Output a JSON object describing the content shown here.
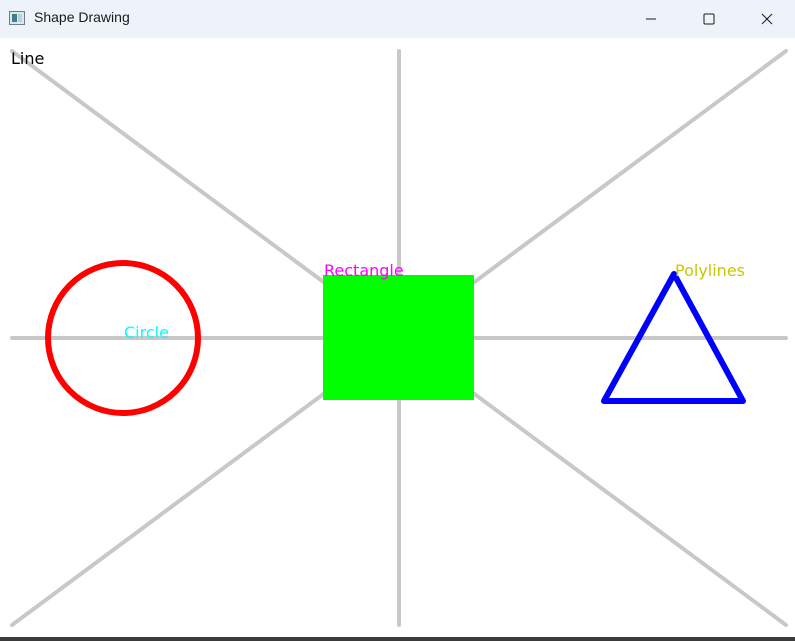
{
  "window": {
    "title": "Shape Drawing",
    "icon": "opencv-window-icon",
    "controls": [
      "minimize-icon",
      "maximize-icon",
      "close-icon"
    ]
  },
  "canvas": {
    "labels": {
      "line": "Line",
      "rectangle": "Rectangle",
      "circle": "Circle",
      "polylines": "Polylines"
    },
    "colors": {
      "background": "#ffffff",
      "guide_lines": "#c8c8c8",
      "line_label": "#000000",
      "rectangle_fill": "#00ff00",
      "rectangle_label": "#ff00ff",
      "circle_stroke": "#ff0000",
      "circle_label": "#00ffff",
      "polylines_stroke": "#0000ff",
      "polylines_label": "#c8c800"
    }
  }
}
